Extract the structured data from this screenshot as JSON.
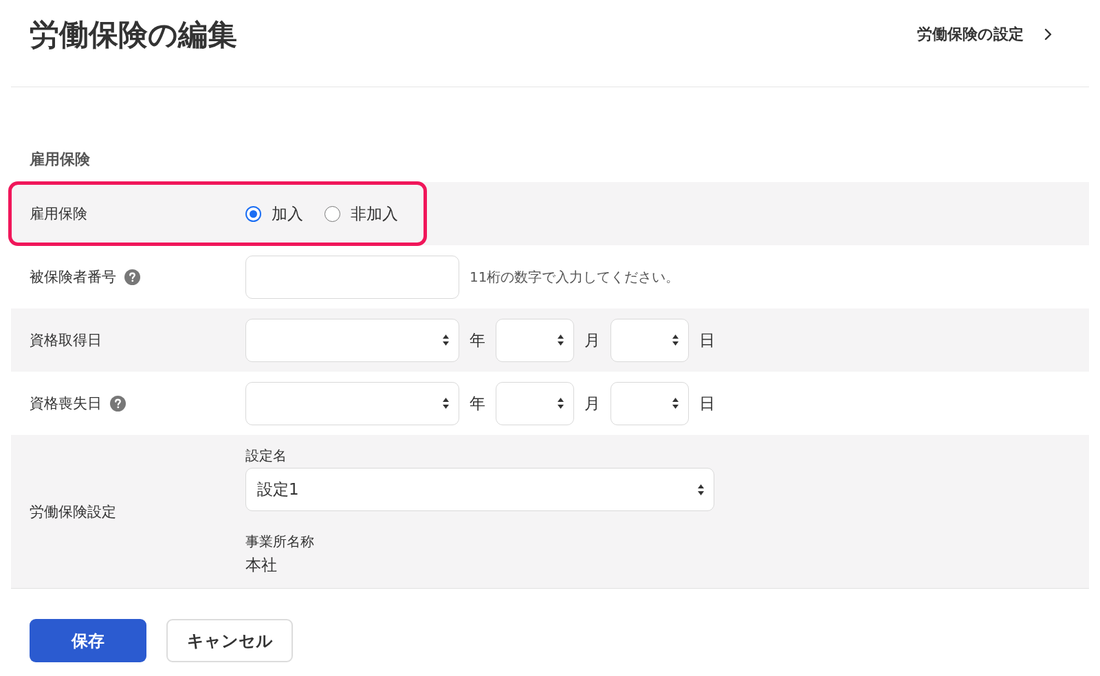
{
  "header": {
    "title": "労働保険の編集",
    "settings_link": "労働保険の設定"
  },
  "section": {
    "title": "雇用保険",
    "rows": [
      {
        "kind": "radio",
        "label": "雇用保険",
        "help": false,
        "highlighted": true,
        "options": [
          {
            "label": "加入",
            "selected": true
          },
          {
            "label": "非加入",
            "selected": false
          }
        ]
      },
      {
        "kind": "text",
        "label": "被保険者番号",
        "help": true,
        "highlighted": false,
        "hint": "11桁の数字で入力してください。"
      },
      {
        "kind": "date",
        "label": "資格取得日",
        "help": false,
        "highlighted": false,
        "fields": [
          {
            "unit": "年"
          },
          {
            "unit": "月"
          },
          {
            "unit": "日"
          }
        ]
      },
      {
        "kind": "date",
        "label": "資格喪失日",
        "help": true,
        "highlighted": false,
        "fields": [
          {
            "unit": "年"
          },
          {
            "unit": "月"
          },
          {
            "unit": "日"
          }
        ]
      },
      {
        "kind": "setting",
        "label": "労働保険設定",
        "help": false,
        "highlighted": false,
        "select": {
          "label": "設定名",
          "value": "設定1"
        },
        "office": {
          "label": "事業所名称",
          "value": "本社"
        }
      }
    ]
  },
  "buttons": [
    {
      "label": "保存",
      "kind": "primary"
    },
    {
      "label": "キャンセル",
      "kind": "secondary"
    }
  ]
}
